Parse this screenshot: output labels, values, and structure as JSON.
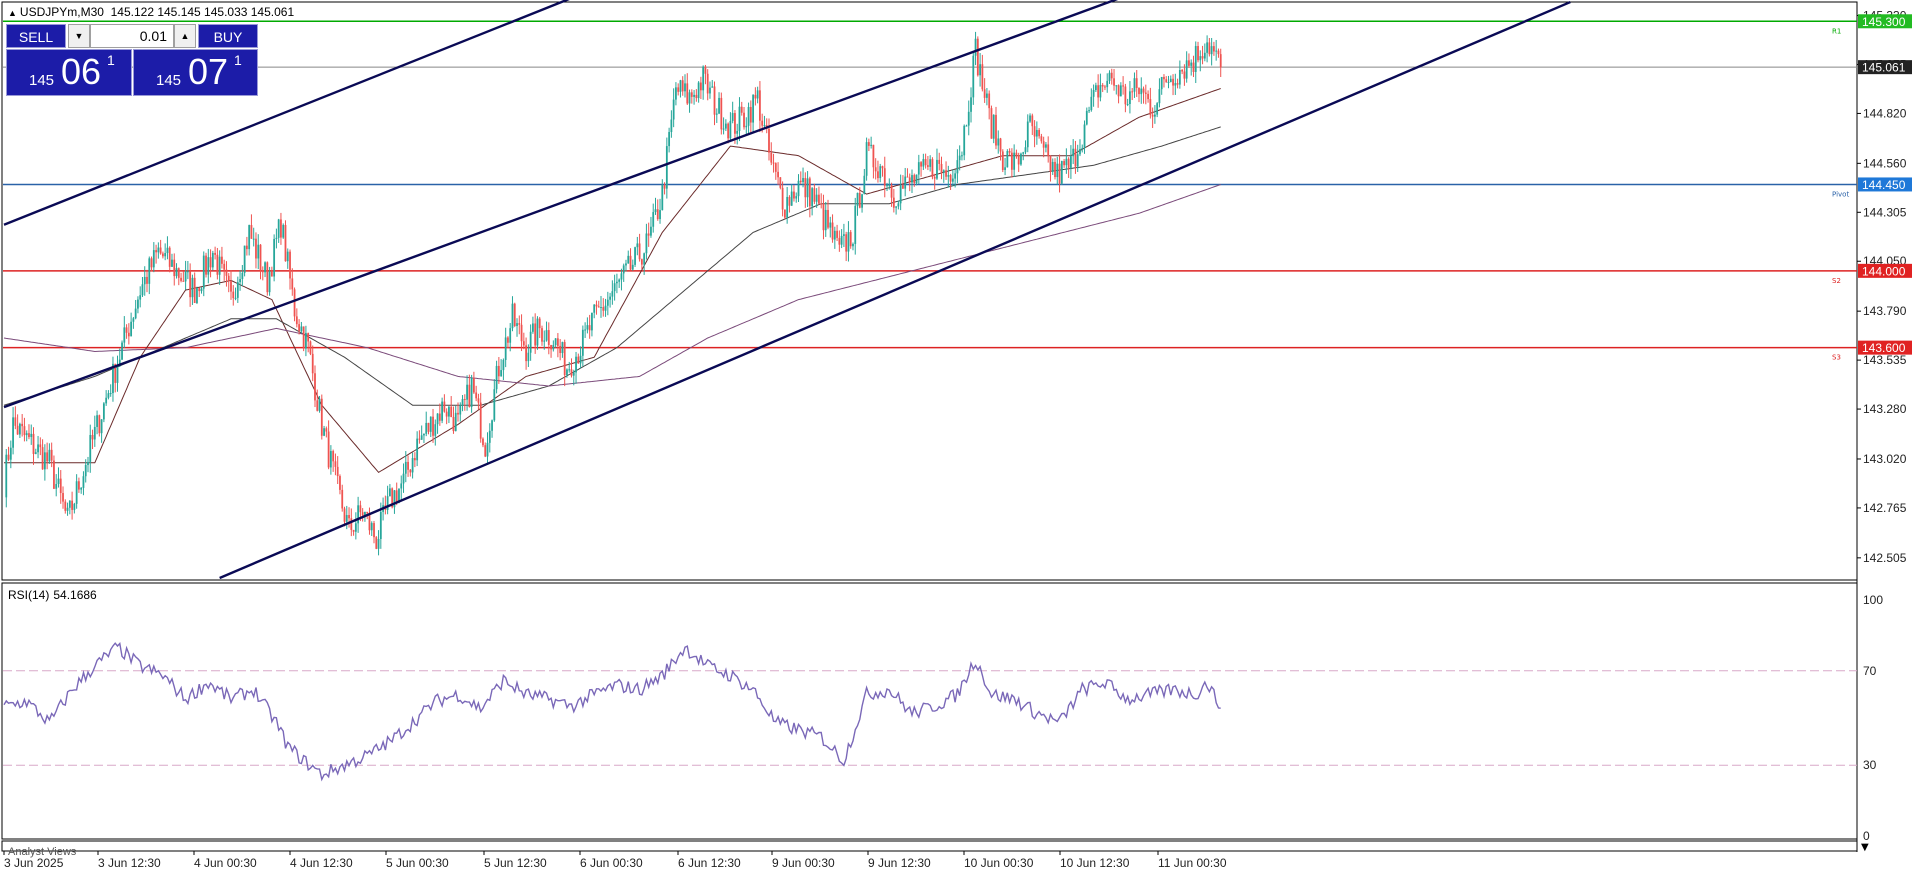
{
  "header": {
    "symbol_tf": "USDJPYm,M30",
    "ohlc": "145.122 145.145 145.033 145.061"
  },
  "trade_panel": {
    "sell_label": "SELL",
    "buy_label": "BUY",
    "lot": "0.01",
    "bid": {
      "small": "145",
      "big": "06",
      "sup": "1"
    },
    "ask": {
      "small": "145",
      "big": "07",
      "sup": "1"
    }
  },
  "rsi_header": {
    "name": "RSI(14)",
    "value": "54.1686"
  },
  "analyst_label": "Analyst Views",
  "colors": {
    "bull": "#26a69a",
    "bear": "#ef5350",
    "channel": "#0a0a55",
    "resistance": "#00aa00",
    "pivot": "#2a62a8",
    "support": "#dd2222",
    "rsi": "#7a68b8",
    "ma_fast": "#6a2a2a",
    "ma_mid": "#444444",
    "ma_slow": "#7a4a7a"
  },
  "chart_data": {
    "type": "candlestick",
    "symbol": "USDJPYm",
    "timeframe": "M30",
    "ylim": [
      142.4,
      145.39
    ],
    "y_ticks": [
      "145.330",
      "145.075",
      "144.820",
      "144.560",
      "144.305",
      "144.050",
      "143.790",
      "143.535",
      "143.280",
      "143.020",
      "142.765",
      "142.505"
    ],
    "x_ticks": [
      "3 Jun 2025",
      "3 Jun 12:30",
      "4 Jun 00:30",
      "4 Jun 12:30",
      "5 Jun 00:30",
      "5 Jun 12:30",
      "6 Jun 00:30",
      "6 Jun 12:30",
      "9 Jun 00:30",
      "9 Jun 12:30",
      "10 Jun 00:30",
      "10 Jun 12:30",
      "11 Jun 00:30"
    ],
    "close_anchors": [
      [
        0,
        142.9
      ],
      [
        4,
        143.2
      ],
      [
        12,
        143.1
      ],
      [
        20,
        143.0
      ],
      [
        28,
        142.7
      ],
      [
        36,
        143.0
      ],
      [
        44,
        143.3
      ],
      [
        52,
        143.6
      ],
      [
        60,
        143.9
      ],
      [
        68,
        144.1
      ],
      [
        76,
        144.0
      ],
      [
        84,
        143.9
      ],
      [
        92,
        144.1
      ],
      [
        100,
        143.85
      ],
      [
        108,
        144.2
      ],
      [
        116,
        143.95
      ],
      [
        122,
        144.25
      ],
      [
        128,
        143.8
      ],
      [
        134,
        143.6
      ],
      [
        140,
        143.2
      ],
      [
        146,
        142.9
      ],
      [
        152,
        142.65
      ],
      [
        158,
        142.75
      ],
      [
        164,
        142.6
      ],
      [
        170,
        142.8
      ],
      [
        176,
        142.9
      ],
      [
        182,
        143.1
      ],
      [
        188,
        143.2
      ],
      [
        194,
        143.3
      ],
      [
        200,
        143.2
      ],
      [
        206,
        143.4
      ],
      [
        212,
        143.1
      ],
      [
        218,
        143.5
      ],
      [
        224,
        143.75
      ],
      [
        230,
        143.6
      ],
      [
        236,
        143.7
      ],
      [
        242,
        143.65
      ],
      [
        248,
        143.5
      ],
      [
        254,
        143.6
      ],
      [
        260,
        143.75
      ],
      [
        266,
        143.85
      ],
      [
        272,
        143.95
      ],
      [
        278,
        144.05
      ],
      [
        284,
        144.15
      ],
      [
        290,
        144.4
      ],
      [
        296,
        144.95
      ],
      [
        302,
        144.9
      ],
      [
        308,
        145.0
      ],
      [
        314,
        144.85
      ],
      [
        320,
        144.75
      ],
      [
        326,
        144.8
      ],
      [
        332,
        144.9
      ],
      [
        338,
        144.55
      ],
      [
        344,
        144.35
      ],
      [
        350,
        144.45
      ],
      [
        356,
        144.4
      ],
      [
        362,
        144.25
      ],
      [
        368,
        144.1
      ],
      [
        374,
        144.2
      ],
      [
        380,
        144.6
      ],
      [
        386,
        144.55
      ],
      [
        392,
        144.4
      ],
      [
        398,
        144.45
      ],
      [
        404,
        144.5
      ],
      [
        410,
        144.55
      ],
      [
        416,
        144.5
      ],
      [
        422,
        144.65
      ],
      [
        428,
        145.15
      ],
      [
        434,
        144.8
      ],
      [
        440,
        144.6
      ],
      [
        446,
        144.55
      ],
      [
        452,
        144.75
      ],
      [
        458,
        144.6
      ],
      [
        464,
        144.5
      ],
      [
        470,
        144.55
      ],
      [
        476,
        144.75
      ],
      [
        482,
        144.95
      ],
      [
        488,
        145.0
      ],
      [
        494,
        144.9
      ],
      [
        500,
        144.95
      ],
      [
        506,
        144.85
      ],
      [
        512,
        145.0
      ],
      [
        518,
        145.05
      ],
      [
        524,
        145.1
      ],
      [
        530,
        145.2
      ],
      [
        536,
        145.06
      ]
    ],
    "channel_lines": [
      [
        [
          0,
          144.24
        ],
        [
          254,
          145.44
        ]
      ],
      [
        [
          0,
          143.29
        ],
        [
          496,
          145.44
        ]
      ],
      [
        [
          95,
          142.4
        ],
        [
          690,
          145.4
        ]
      ]
    ],
    "levels": [
      {
        "value": 145.3,
        "label": "145.300",
        "tag": "R1",
        "kind": "resistance"
      },
      {
        "value": 145.061,
        "label": "145.061",
        "tag": "",
        "kind": "price"
      },
      {
        "value": 144.45,
        "label": "144.450",
        "tag": "Pivot",
        "kind": "pivot"
      },
      {
        "value": 144.0,
        "label": "144.000",
        "tag": "S2",
        "kind": "support"
      },
      {
        "value": 143.6,
        "label": "143.600",
        "tag": "S3",
        "kind": "support"
      }
    ],
    "moving_averages": [
      {
        "period": 20,
        "anchors": [
          [
            0,
            143.0
          ],
          [
            40,
            143.0
          ],
          [
            60,
            143.55
          ],
          [
            80,
            143.9
          ],
          [
            100,
            143.95
          ],
          [
            118,
            143.85
          ],
          [
            140,
            143.3
          ],
          [
            165,
            142.95
          ],
          [
            200,
            143.2
          ],
          [
            230,
            143.45
          ],
          [
            260,
            143.55
          ],
          [
            290,
            144.2
          ],
          [
            320,
            144.65
          ],
          [
            350,
            144.6
          ],
          [
            380,
            144.4
          ],
          [
            410,
            144.5
          ],
          [
            440,
            144.6
          ],
          [
            470,
            144.6
          ],
          [
            500,
            144.8
          ],
          [
            536,
            144.95
          ]
        ]
      },
      {
        "period": 50,
        "anchors": [
          [
            0,
            143.3
          ],
          [
            40,
            143.45
          ],
          [
            70,
            143.6
          ],
          [
            100,
            143.75
          ],
          [
            120,
            143.75
          ],
          [
            150,
            143.55
          ],
          [
            180,
            143.3
          ],
          [
            210,
            143.3
          ],
          [
            240,
            143.4
          ],
          [
            270,
            143.6
          ],
          [
            300,
            143.9
          ],
          [
            330,
            144.2
          ],
          [
            360,
            144.35
          ],
          [
            390,
            144.35
          ],
          [
            420,
            144.45
          ],
          [
            450,
            144.5
          ],
          [
            480,
            144.55
          ],
          [
            510,
            144.65
          ],
          [
            536,
            144.75
          ]
        ]
      },
      {
        "period": 200,
        "anchors": [
          [
            0,
            143.65
          ],
          [
            40,
            143.58
          ],
          [
            80,
            143.6
          ],
          [
            120,
            143.7
          ],
          [
            160,
            143.6
          ],
          [
            200,
            143.45
          ],
          [
            240,
            143.4
          ],
          [
            280,
            143.45
          ],
          [
            310,
            143.65
          ],
          [
            350,
            143.85
          ],
          [
            400,
            144.0
          ],
          [
            450,
            144.15
          ],
          [
            500,
            144.3
          ],
          [
            536,
            144.45
          ]
        ]
      }
    ],
    "rsi": {
      "period": 14,
      "ylim": [
        0,
        100
      ],
      "levels": [
        30,
        70
      ],
      "y_ticks": [
        "100",
        "70",
        "30",
        "0"
      ],
      "last": 54.1686,
      "anchors": [
        [
          0,
          55
        ],
        [
          10,
          57
        ],
        [
          20,
          48
        ],
        [
          30,
          62
        ],
        [
          40,
          72
        ],
        [
          50,
          80
        ],
        [
          60,
          72
        ],
        [
          70,
          68
        ],
        [
          80,
          58
        ],
        [
          90,
          65
        ],
        [
          100,
          58
        ],
        [
          110,
          62
        ],
        [
          120,
          48
        ],
        [
          125,
          38
        ],
        [
          132,
          32
        ],
        [
          140,
          26
        ],
        [
          150,
          30
        ],
        [
          160,
          34
        ],
        [
          170,
          40
        ],
        [
          180,
          48
        ],
        [
          190,
          57
        ],
        [
          200,
          60
        ],
        [
          210,
          54
        ],
        [
          220,
          66
        ],
        [
          230,
          60
        ],
        [
          240,
          58
        ],
        [
          250,
          55
        ],
        [
          260,
          60
        ],
        [
          270,
          64
        ],
        [
          280,
          62
        ],
        [
          290,
          68
        ],
        [
          300,
          80
        ],
        [
          310,
          72
        ],
        [
          320,
          68
        ],
        [
          330,
          62
        ],
        [
          340,
          48
        ],
        [
          350,
          45
        ],
        [
          360,
          42
        ],
        [
          370,
          32
        ],
        [
          380,
          60
        ],
        [
          390,
          62
        ],
        [
          400,
          52
        ],
        [
          410,
          55
        ],
        [
          420,
          60
        ],
        [
          428,
          75
        ],
        [
          435,
          60
        ],
        [
          445,
          58
        ],
        [
          455,
          52
        ],
        [
          465,
          48
        ],
        [
          475,
          62
        ],
        [
          485,
          65
        ],
        [
          495,
          58
        ],
        [
          505,
          60
        ],
        [
          515,
          62
        ],
        [
          525,
          60
        ],
        [
          530,
          65
        ],
        [
          536,
          54.17
        ]
      ]
    }
  }
}
